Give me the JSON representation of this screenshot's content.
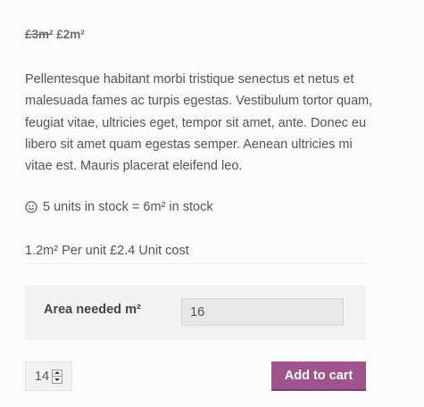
{
  "product": {
    "old_price": "£3m²",
    "new_price": "£2m²",
    "description": "Pellentesque habitant morbi tristique senectus et netus et malesuada fames ac turpis egestas. Vestibulum tortor quam, feugiat vitae, ultricies eget, tempor sit amet, ante. Donec eu libero sit amet quam egestas semper. Aenean ultricies mi vitae est. Mauris placerat eleifend leo.",
    "stock_icon": "smiley-icon",
    "stock_text": "5 units in stock = 6m² in stock",
    "unit_info": "1.2m² Per unit £2.4 Unit cost"
  },
  "area": {
    "label": "Area needed m²",
    "value": "16"
  },
  "cart": {
    "quantity": "14",
    "button_label": "Add to cart",
    "button_color": "#a0548e"
  }
}
